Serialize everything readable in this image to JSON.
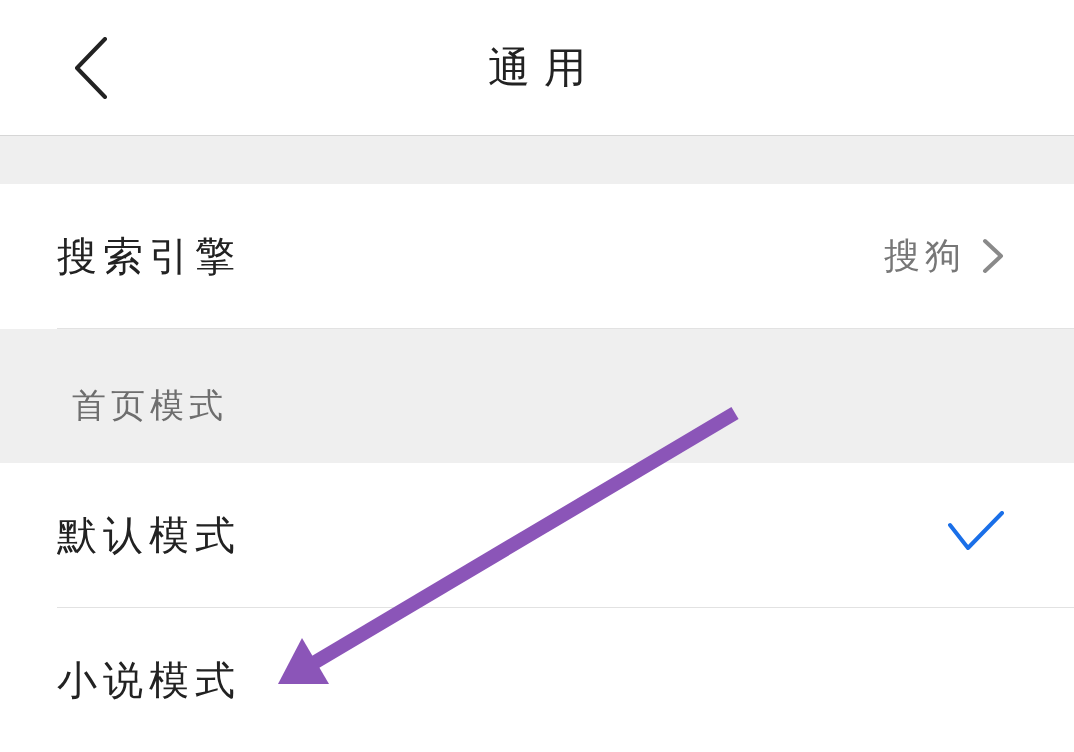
{
  "header": {
    "title": "通用"
  },
  "groups": [
    {
      "items": [
        {
          "kind": "link",
          "label": "搜索引擎",
          "value": "搜狗"
        }
      ]
    },
    {
      "title": "首页模式",
      "items": [
        {
          "kind": "option",
          "label": "默认模式",
          "selected": true
        },
        {
          "kind": "option",
          "label": "小说模式",
          "selected": false
        }
      ]
    }
  ]
}
